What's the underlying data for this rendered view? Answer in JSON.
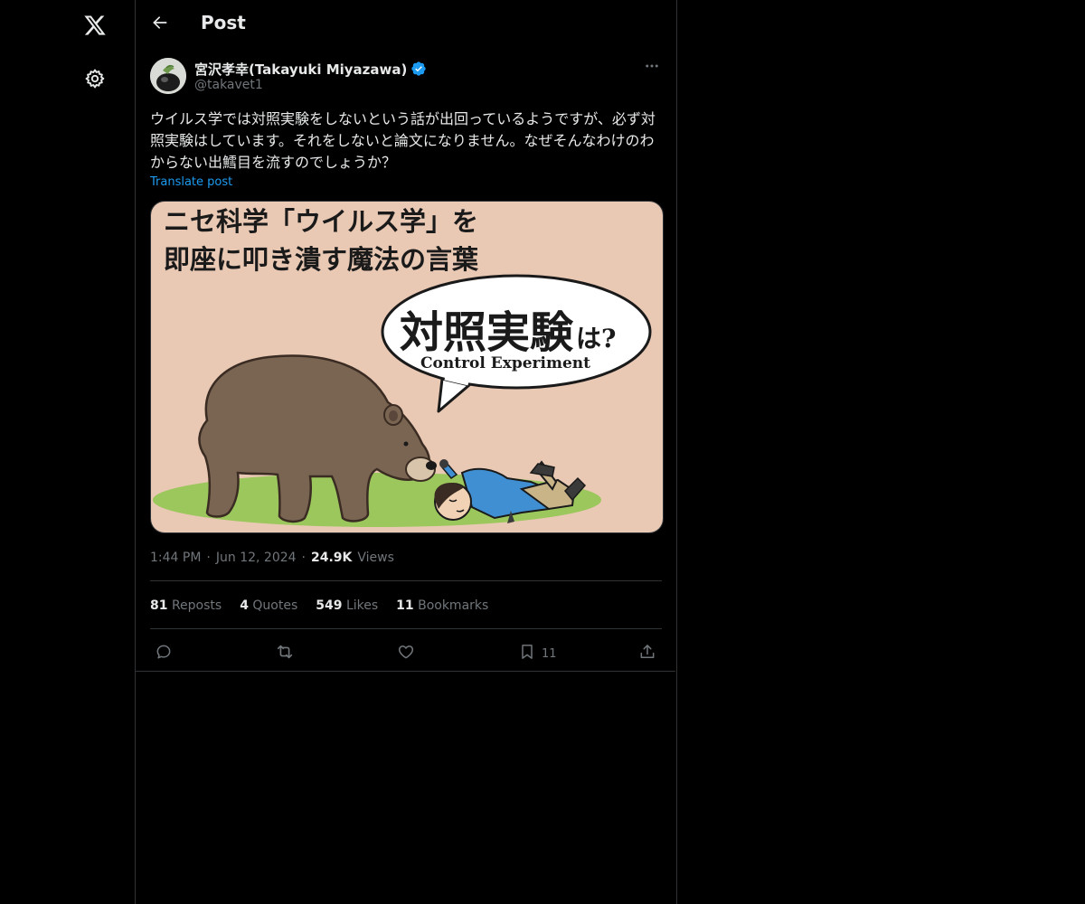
{
  "header": {
    "title": "Post"
  },
  "author": {
    "display_name": "宮沢孝幸(Takayuki Miyazawa)",
    "handle": "@takavet1"
  },
  "post": {
    "text": "ウイルス学では対照実験をしないという話が出回っているようですが、必ず対照実験はしています。それをしないと論文になりません。なぜそんなわけのわからない出鱈目を流すのでしょうか？",
    "translate_label": "Translate post"
  },
  "media": {
    "title_line1": "ニセ科学「ウイルス学」を",
    "title_line2": "即座に叩き潰す魔法の言葉",
    "bubble_main": "対照実験",
    "bubble_suffix": "は?",
    "bubble_english": "Control Experiment"
  },
  "meta": {
    "time": "1:44 PM",
    "separator": "·",
    "date": "Jun 12, 2024",
    "views_count": "24.9K",
    "views_label": "Views"
  },
  "stats": {
    "reposts_count": "81",
    "reposts_label": "Reposts",
    "quotes_count": "4",
    "quotes_label": "Quotes",
    "likes_count": "549",
    "likes_label": "Likes",
    "bookmarks_count": "11",
    "bookmarks_label": "Bookmarks"
  },
  "actions": {
    "bookmark_count": "11"
  },
  "icons": {
    "logo": "x-logo-icon",
    "settings": "gear-icon",
    "back": "arrow-left-icon",
    "verified": "verified-badge-icon",
    "more": "more-dots-icon",
    "reply": "reply-icon",
    "repost": "repost-icon",
    "like": "heart-icon",
    "bookmark": "bookmark-icon",
    "share": "share-icon"
  },
  "colors": {
    "background": "#000000",
    "text": "#e7e9ea",
    "muted": "#71767b",
    "accent": "#1d9bf0",
    "border": "#2f3336"
  }
}
